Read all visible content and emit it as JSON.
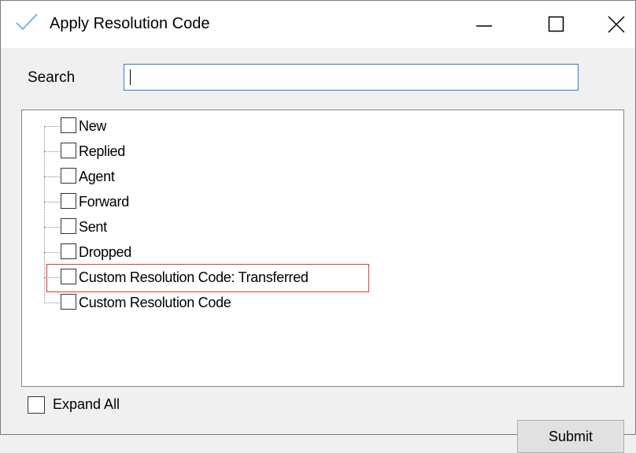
{
  "window": {
    "title": "Apply Resolution Code",
    "app_icon": "checkmark-icon",
    "controls": [
      "minimize-icon",
      "maximize-icon",
      "close-icon"
    ]
  },
  "search": {
    "label": "Search",
    "value": ""
  },
  "tree": {
    "items": [
      {
        "label": "New",
        "checked": false
      },
      {
        "label": "Replied",
        "checked": false
      },
      {
        "label": "Agent",
        "checked": false
      },
      {
        "label": "Forward",
        "checked": false
      },
      {
        "label": "Sent",
        "checked": false
      },
      {
        "label": "Dropped",
        "checked": false
      },
      {
        "label": "Custom Resolution Code: Transferred",
        "checked": false,
        "highlighted": true
      },
      {
        "label": "Custom Resolution Code",
        "checked": false
      }
    ]
  },
  "footer": {
    "expand_all_label": "Expand All",
    "expand_all_checked": false,
    "submit_label": "Submit"
  },
  "colors": {
    "accent": "#2f7bd6",
    "highlight": "#e03a3a",
    "icon": "#7fb2e5"
  }
}
